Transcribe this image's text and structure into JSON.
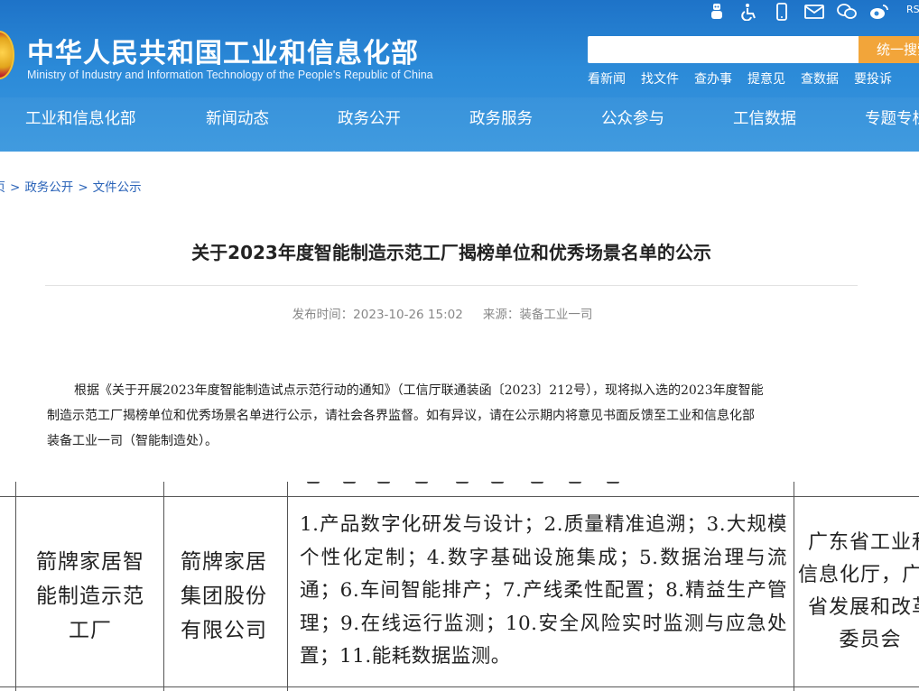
{
  "header": {
    "title_cn": "中华人民共和国工业和信息化部",
    "title_en": "Ministry of Industry and Information Technology of the People's Republic of China",
    "toolbar_icons": [
      "robot-icon",
      "accessibility-icon",
      "mobile-icon",
      "mail-icon",
      "wechat-icon",
      "weibo-icon",
      "rss-icon"
    ],
    "rss_label": "RS",
    "search": {
      "value": "",
      "button_label": "统一搜索"
    },
    "quick_links": [
      "看新闻",
      "找文件",
      "查办事",
      "提意见",
      "查数据",
      "要投诉"
    ],
    "nav": [
      "工业和信息化部",
      "新闻动态",
      "政务公开",
      "政务服务",
      "公众参与",
      "工信数据",
      "专题专栏"
    ]
  },
  "breadcrumb": [
    "首页",
    "政务公开",
    "文件公示"
  ],
  "article": {
    "title": "关于2023年度智能制造示范工厂揭榜单位和优秀场景名单的公示",
    "published_label": "发布时间：",
    "published_value": "2023-10-26 15:02",
    "source_label": "来源：",
    "source_value": "装备工业一司",
    "body_lines": [
      "根据《关于开展2023年度智能制造试点示范行动的通知》（工信厅联通装函〔2023〕212号），现将拟入选的2023年度智能",
      "制造示范工厂揭榜单位和优秀场景名单进行公示，请社会各界监督。如有异议，请在公示期内将意见书面反馈至工业和信息化部",
      "装备工业一司（智能制造处）。"
    ]
  },
  "table_row": {
    "factory_name": "箭牌家居智能制造示范工厂",
    "factory_lines": [
      "箭牌家居智",
      "能制造示范",
      "工厂"
    ],
    "company_lines": [
      "箭牌家居",
      "集团股份",
      "有限公司"
    ],
    "scenario_text": "1.产品数字化研发与设计；2.质量精准追溯；3.大规模个性化定制；4.数字基础设施集成；5.数据治理与流通；6.车间智能排产；7.产线柔性配置；8.精益生产管理；9.在线运行监测；10.安全风险实时监测与应急处置；11.能耗数据监测。",
    "recommender_lines": [
      "广东省工业和",
      "信息化厅，广东",
      "省发展和改革",
      "委员会"
    ]
  }
}
